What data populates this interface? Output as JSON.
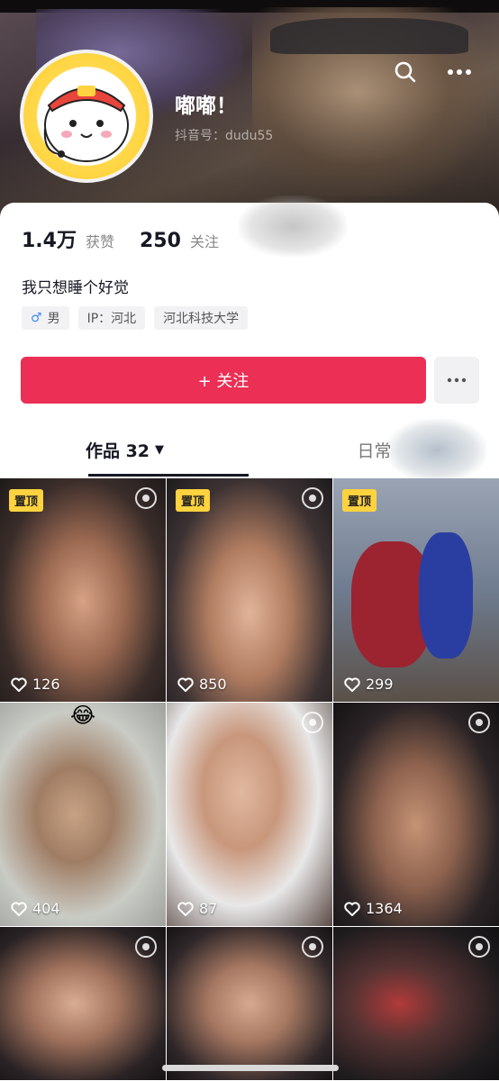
{
  "profile": {
    "name": "嘟嘟！",
    "douyin_id": "抖音号：dudu55"
  },
  "stats": {
    "likes_count": "1.4万",
    "likes_label": "获赞",
    "following_count": "250",
    "following_label": "关注"
  },
  "bio": "我只想睡个好觉",
  "tags": {
    "gender_icon": "♂",
    "gender": "男",
    "ip": "IP：河北",
    "school": "河北科技大学"
  },
  "actions": {
    "follow_label": "+ 关注"
  },
  "tabs": {
    "works_label": "作品 32",
    "works_caret": "▼",
    "daily_label": "日常"
  },
  "videos": [
    {
      "pinned": "置顶",
      "likes": "126"
    },
    {
      "pinned": "置顶",
      "likes": "850"
    },
    {
      "pinned": "置顶",
      "likes": "299"
    },
    {
      "likes": "404",
      "emoji": "😂"
    },
    {
      "likes": "87"
    },
    {
      "likes": "1364"
    },
    {
      "likes": ""
    },
    {
      "likes": ""
    },
    {
      "likes": ""
    }
  ],
  "colors": {
    "follow_button": "#eb2f55",
    "pin_badge": "#ffd23f"
  }
}
